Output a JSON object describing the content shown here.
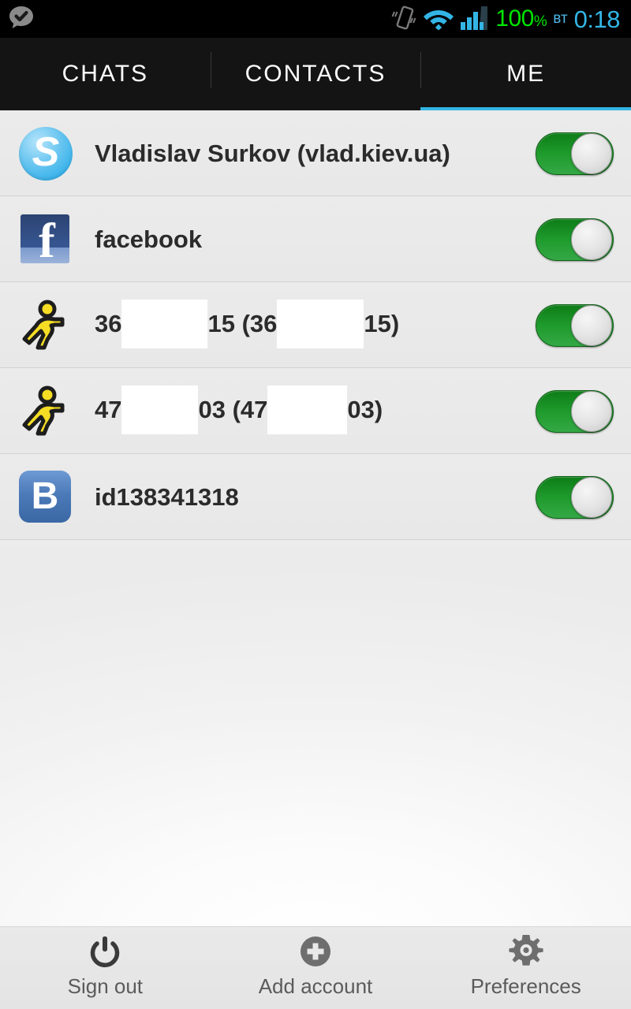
{
  "statusbar": {
    "notification_icon": "chat-check-icon",
    "vibrate_icon": "vibrate-icon",
    "wifi_icon": "wifi-icon",
    "signal_icon": "signal-bars-icon",
    "battery_value": "100",
    "battery_unit": "%",
    "day": "вт",
    "clock": "0:18",
    "battery_color": "#00e500",
    "clock_color": "#33b5e5"
  },
  "tabs": [
    {
      "label": "CHATS",
      "active": false
    },
    {
      "label": "CONTACTS",
      "active": false
    },
    {
      "label": "ME",
      "active": true
    }
  ],
  "tab_indicator_color": "#33b5e5",
  "accounts": [
    {
      "icon": "skype-icon",
      "label_before": "Vladislav Surkov (vlad.kiev.ua)",
      "label_after": "",
      "label_mid": "",
      "label_end": "",
      "redacted": false,
      "toggle_on": true
    },
    {
      "icon": "facebook-icon",
      "label_before": "facebook",
      "label_after": "",
      "label_mid": "",
      "label_end": "",
      "redacted": false,
      "toggle_on": true
    },
    {
      "icon": "aim-icon",
      "label_before": "36",
      "label_after": "15 (36",
      "label_mid": "",
      "label_end": "15)",
      "redacted": true,
      "redact1_width": 109,
      "redact2_width": 110,
      "toggle_on": true
    },
    {
      "icon": "aim-icon",
      "label_before": "47",
      "label_after": "03 (47",
      "label_mid": "",
      "label_end": "03)",
      "redacted": true,
      "redact1_width": 97,
      "redact2_width": 101,
      "toggle_on": true
    },
    {
      "icon": "vk-icon",
      "label_before": "id138341318",
      "label_after": "",
      "label_mid": "",
      "label_end": "",
      "redacted": false,
      "toggle_on": true
    }
  ],
  "toggle_on_color": "#1f9b2c",
  "bottombar": [
    {
      "icon": "power-icon",
      "label": "Sign out"
    },
    {
      "icon": "plus-circle-icon",
      "label": "Add account"
    },
    {
      "icon": "gear-icon",
      "label": "Preferences"
    }
  ]
}
